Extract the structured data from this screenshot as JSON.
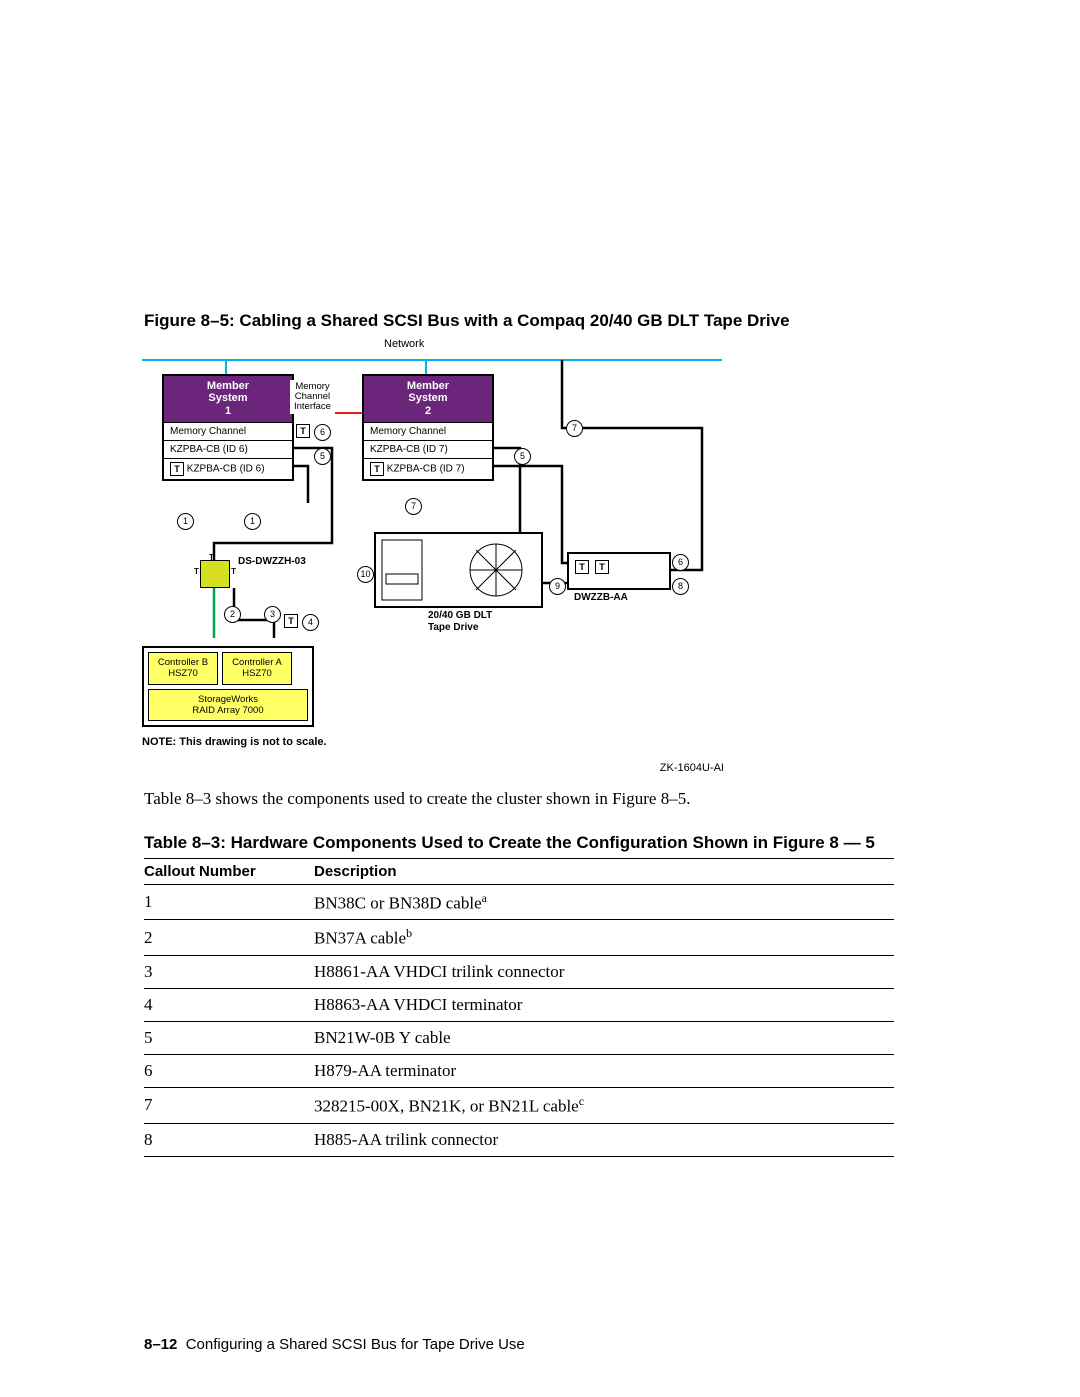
{
  "figure": {
    "title": "Figure 8–5: Cabling a Shared SCSI Bus with a Compaq 20/40 GB DLT Tape Drive",
    "network_label": "Network",
    "system1": {
      "head1": "Member",
      "head2": "System",
      "head3": "1",
      "r1": "Memory Channel",
      "r2": "KZPBA-CB (ID 6)",
      "r3": "KZPBA-CB (ID 6)"
    },
    "mci": "Memory\nChannel\nInterface",
    "system2": {
      "head1": "Member",
      "head2": "System",
      "head3": "2",
      "r1": "Memory Channel",
      "r2": "KZPBA-CB (ID 7)",
      "r3": "KZPBA-CB (ID 7)"
    },
    "dwzzh": "DS-DWZZH-03",
    "tape": "20/40 GB DLT\nTape Drive",
    "dwzzb": "DWZZB-AA",
    "raid": {
      "ctrlB": "Controller B\nHSZ70",
      "ctrlA": "Controller A\nHSZ70",
      "sw": "StorageWorks\nRAID Array 7000"
    },
    "note": "NOTE: This drawing is not to scale.",
    "zk": "ZK-1604U-AI",
    "callouts": {
      "c1": "1",
      "c2": "2",
      "c3": "3",
      "c4": "4",
      "c5": "5",
      "c6": "6",
      "c7": "7",
      "c8": "8",
      "c9": "9",
      "c10": "10"
    },
    "T": "T"
  },
  "body_text": "Table 8–3 shows the components used to create the cluster shown in Figure 8–5.",
  "table": {
    "title": "Table 8–3: Hardware Components Used to Create the Configuration Shown in Figure 8 — 5",
    "headers": {
      "c1": "Callout Number",
      "c2": "Description"
    },
    "rows": [
      {
        "n": "1",
        "d": "BN38C or BN38D cable",
        "sup": "a"
      },
      {
        "n": "2",
        "d": "BN37A cable",
        "sup": "b"
      },
      {
        "n": "3",
        "d": "H8861-AA VHDCI trilink connector",
        "sup": ""
      },
      {
        "n": "4",
        "d": "H8863-AA VHDCI terminator",
        "sup": ""
      },
      {
        "n": "5",
        "d": "BN21W-0B Y cable",
        "sup": ""
      },
      {
        "n": "6",
        "d": "H879-AA terminator",
        "sup": ""
      },
      {
        "n": "7",
        "d": "328215-00X, BN21K, or BN21L cable",
        "sup": "c"
      },
      {
        "n": "8",
        "d": "H885-AA trilink connector",
        "sup": ""
      }
    ]
  },
  "footer": {
    "pageno": "8–12",
    "title": "Configuring a Shared SCSI Bus for Tape Drive Use"
  }
}
